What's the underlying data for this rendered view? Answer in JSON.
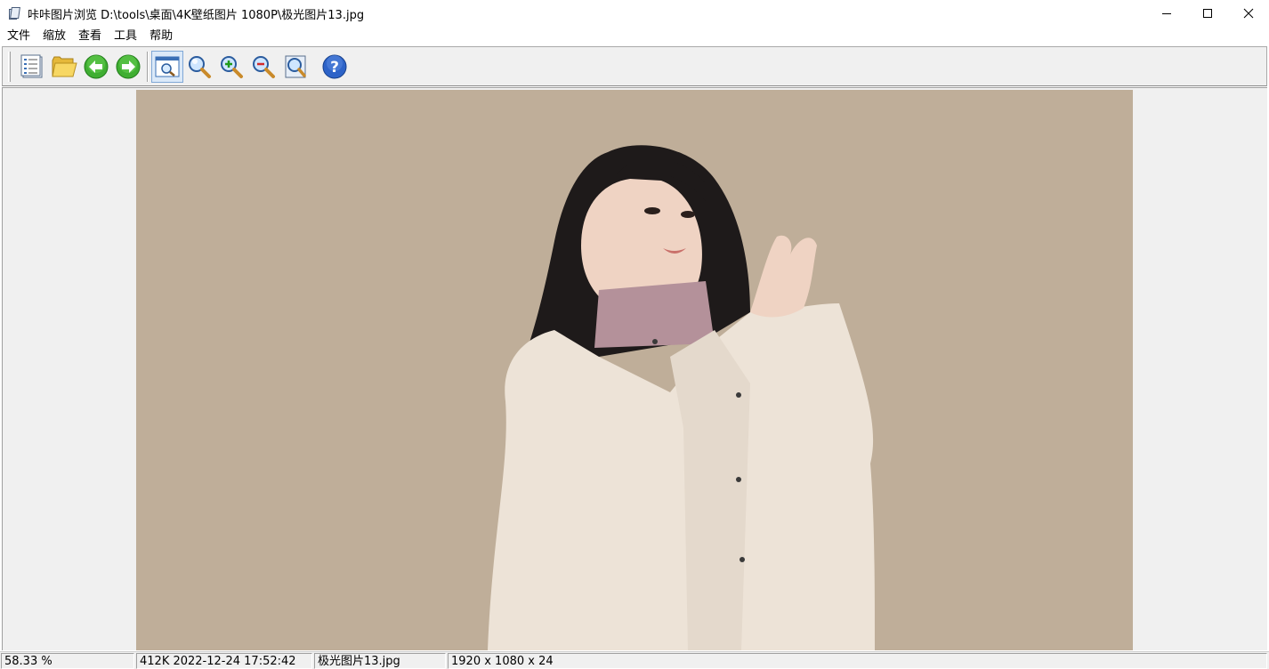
{
  "window": {
    "app_name": "咔咔图片浏览",
    "title": "咔咔图片浏览 D:\\tools\\桌面\\4K壁纸图片 1080P\\极光图片13.jpg",
    "controls": {
      "minimize": "minimize-icon",
      "maximize": "maximize-icon",
      "close": "close-icon"
    }
  },
  "menu": [
    "文件",
    "缩放",
    "查看",
    "工具",
    "帮助"
  ],
  "toolbar": {
    "buttons": [
      {
        "name": "thumbnail-list",
        "icon": "list-icon"
      },
      {
        "name": "open-folder",
        "icon": "folder-icon"
      },
      {
        "name": "previous-image",
        "icon": "arrow-left-icon"
      },
      {
        "name": "next-image",
        "icon": "arrow-right-icon"
      },
      {
        "name": "fit-window",
        "icon": "fit-window-icon",
        "pressed": true
      },
      {
        "name": "actual-size",
        "icon": "magnifier-icon"
      },
      {
        "name": "zoom-in",
        "icon": "zoom-in-icon"
      },
      {
        "name": "zoom-out",
        "icon": "zoom-out-icon"
      },
      {
        "name": "fullscreen",
        "icon": "fullscreen-icon"
      },
      {
        "name": "help",
        "icon": "help-icon"
      }
    ]
  },
  "image": {
    "subject": "photo-portrait",
    "background_color": "#bfae99",
    "viewer_background_color": "#f0f0f0"
  },
  "status": {
    "zoom": "58.33 %",
    "file_info": "412K 2022-12-24 17:52:42",
    "file_name": "极光图片13.jpg",
    "dimensions": "1920 x 1080 x 24"
  }
}
